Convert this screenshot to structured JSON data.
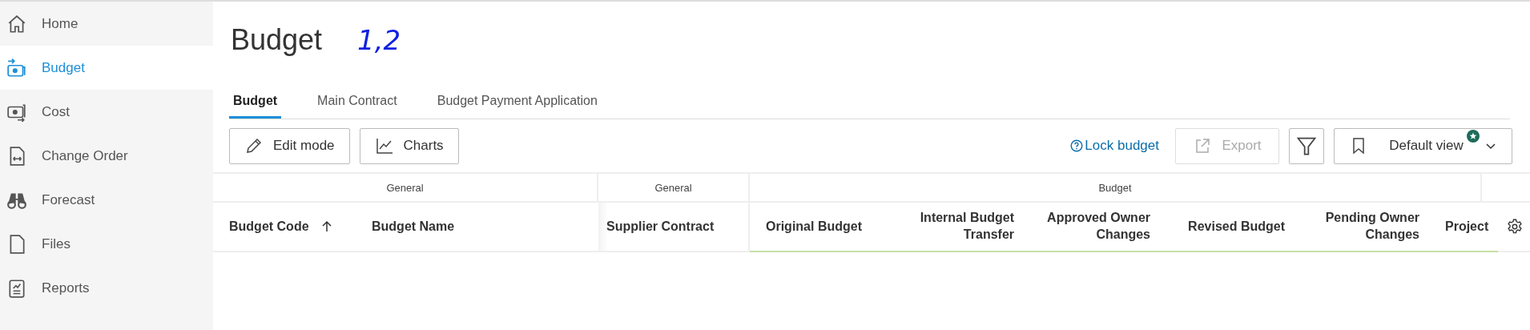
{
  "sidebar": {
    "items": [
      {
        "label": "Home",
        "selected": false
      },
      {
        "label": "Budget",
        "selected": true
      },
      {
        "label": "Cost",
        "selected": false
      },
      {
        "label": "Change Order",
        "selected": false
      },
      {
        "label": "Forecast",
        "selected": false
      },
      {
        "label": "Files",
        "selected": false
      },
      {
        "label": "Reports",
        "selected": false
      }
    ]
  },
  "page": {
    "title": "Budget",
    "annotation": "1,2"
  },
  "tabs": [
    {
      "label": "Budget",
      "selected": true
    },
    {
      "label": "Main Contract",
      "selected": false
    },
    {
      "label": "Budget Payment Application",
      "selected": false
    }
  ],
  "toolbar": {
    "left": [
      {
        "label": "Edit mode"
      },
      {
        "label": "Charts"
      }
    ],
    "lock_link": "Lock budget",
    "export": {
      "label": "Export",
      "disabled": true
    },
    "view": {
      "label": "Default view",
      "starred": true
    }
  },
  "table": {
    "groups": [
      {
        "label": "General"
      },
      {
        "label": "General"
      },
      {
        "label": "Budget"
      }
    ],
    "columns": [
      {
        "label": "Budget Code",
        "sorted": true
      },
      {
        "label": "Budget Name",
        "sorted": false
      },
      {
        "label": "Supplier Contract",
        "sorted": false
      },
      {
        "label": "Original Budget",
        "sorted": false
      },
      {
        "label": "Internal Budget Transfer",
        "sorted": false
      },
      {
        "label": "Approved Owner Changes",
        "sorted": false
      },
      {
        "label": "Revised Budget",
        "sorted": false
      },
      {
        "label": "Pending Owner Changes",
        "sorted": false
      },
      {
        "label": "Project",
        "sorted": false
      }
    ]
  }
}
